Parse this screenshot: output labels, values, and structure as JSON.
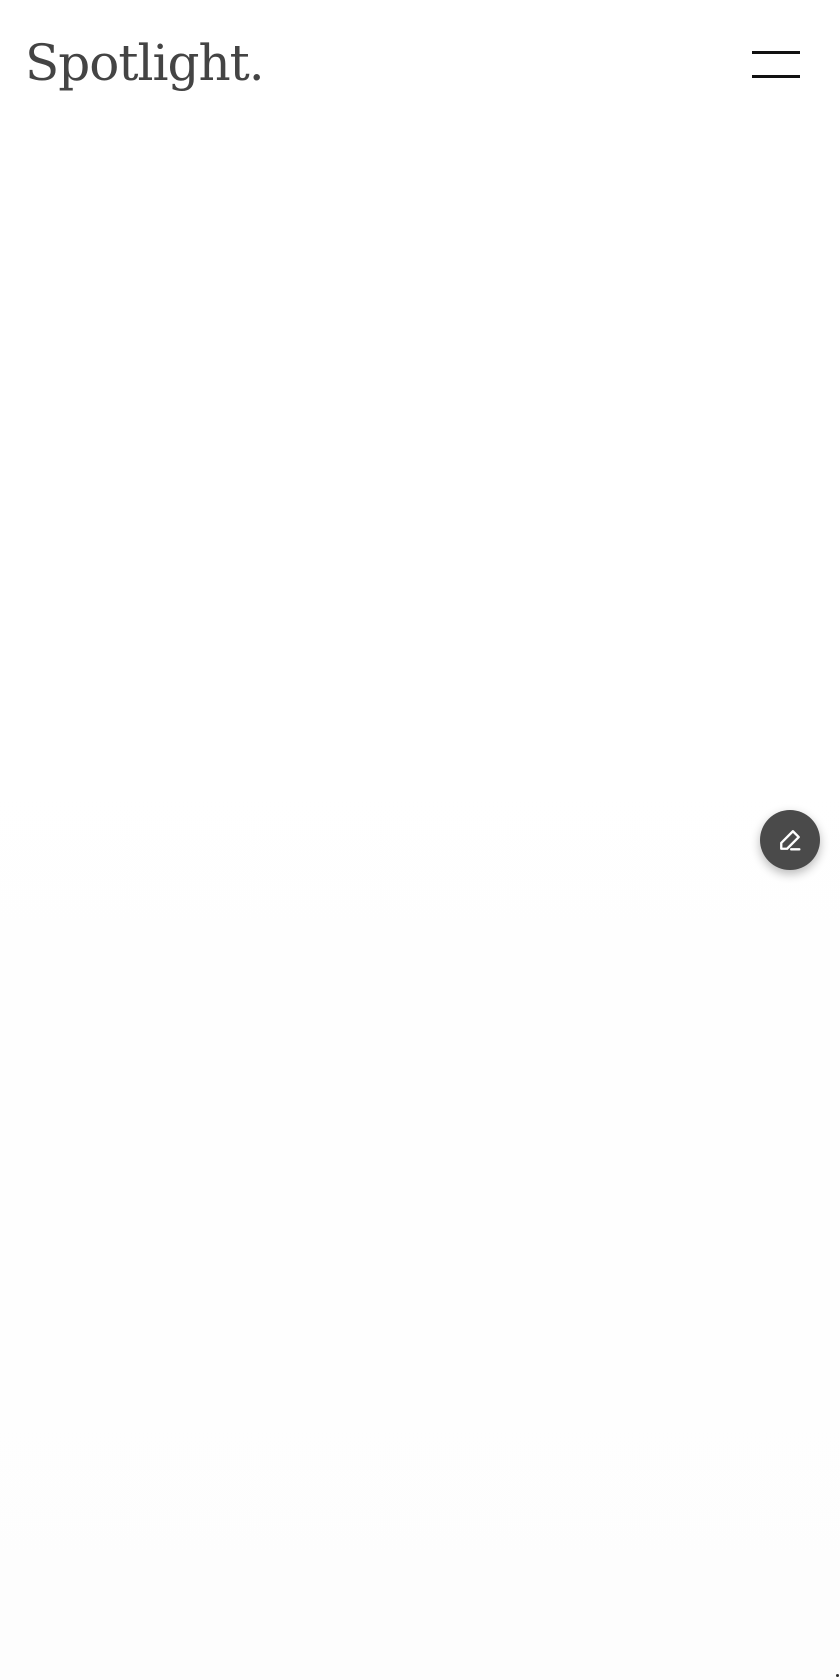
{
  "header": {
    "logo_text": "Spotlight.",
    "menu_icon": "hamburger-menu-icon"
  },
  "fab": {
    "icon": "edit-pencil-icon"
  },
  "colors": {
    "logo": "#444444",
    "menu_lines": "#111111",
    "fab_background": "#4a4a4a",
    "fab_icon": "#ffffff",
    "page_background": "#ffffff"
  }
}
